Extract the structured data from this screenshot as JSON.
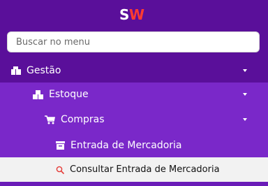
{
  "logo": {
    "text": "SW"
  },
  "search": {
    "placeholder": "Buscar no menu"
  },
  "menu": {
    "gestao": {
      "label": "Gestão",
      "icon": "boxes-icon"
    },
    "estoque": {
      "label": "Estoque",
      "icon": "stacked-boxes-icon"
    },
    "compras": {
      "label": "Compras",
      "icon": "cart-icon"
    },
    "entrada": {
      "label": "Entrada de Mercadoria",
      "icon": "archive-icon"
    },
    "consultar": {
      "label": "Consultar Entrada de Mercadoria",
      "icon": "search-icon",
      "selected": true
    }
  },
  "colors": {
    "sidebar_bg": "#5a0f9a",
    "submenu_bg": "#7a28c9",
    "selected_bg": "#f2f2f2",
    "logo_accent": "#ff3b30"
  }
}
